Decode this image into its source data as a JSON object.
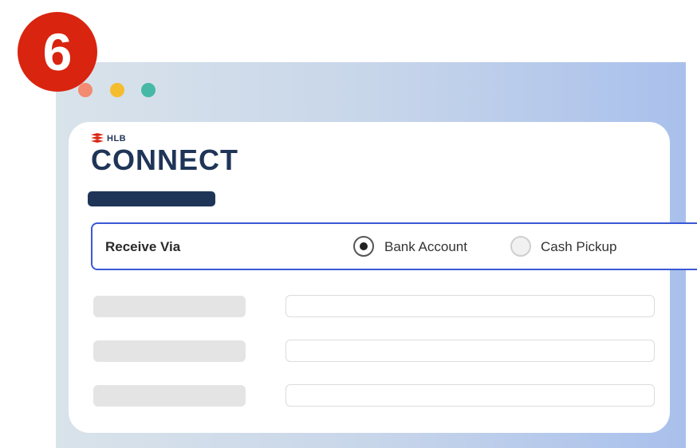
{
  "step": {
    "number": "6"
  },
  "window": {
    "traffic_lights": [
      "close-dot",
      "minimize-dot",
      "maximize-dot"
    ]
  },
  "brand": {
    "small_text": "HLB",
    "wordmark": "CONNECT",
    "color": "#1f3558"
  },
  "form": {
    "receive_via": {
      "label": "Receive Via",
      "options": [
        {
          "label": "Bank Account",
          "selected": true
        },
        {
          "label": "Cash Pickup",
          "selected": false
        }
      ]
    },
    "rows": [
      {
        "label": "",
        "value": ""
      },
      {
        "label": "",
        "value": ""
      },
      {
        "label": "",
        "value": ""
      }
    ]
  },
  "colors": {
    "badge": "#d92410",
    "accent_border": "#3a58d6",
    "navy": "#1f3558"
  }
}
